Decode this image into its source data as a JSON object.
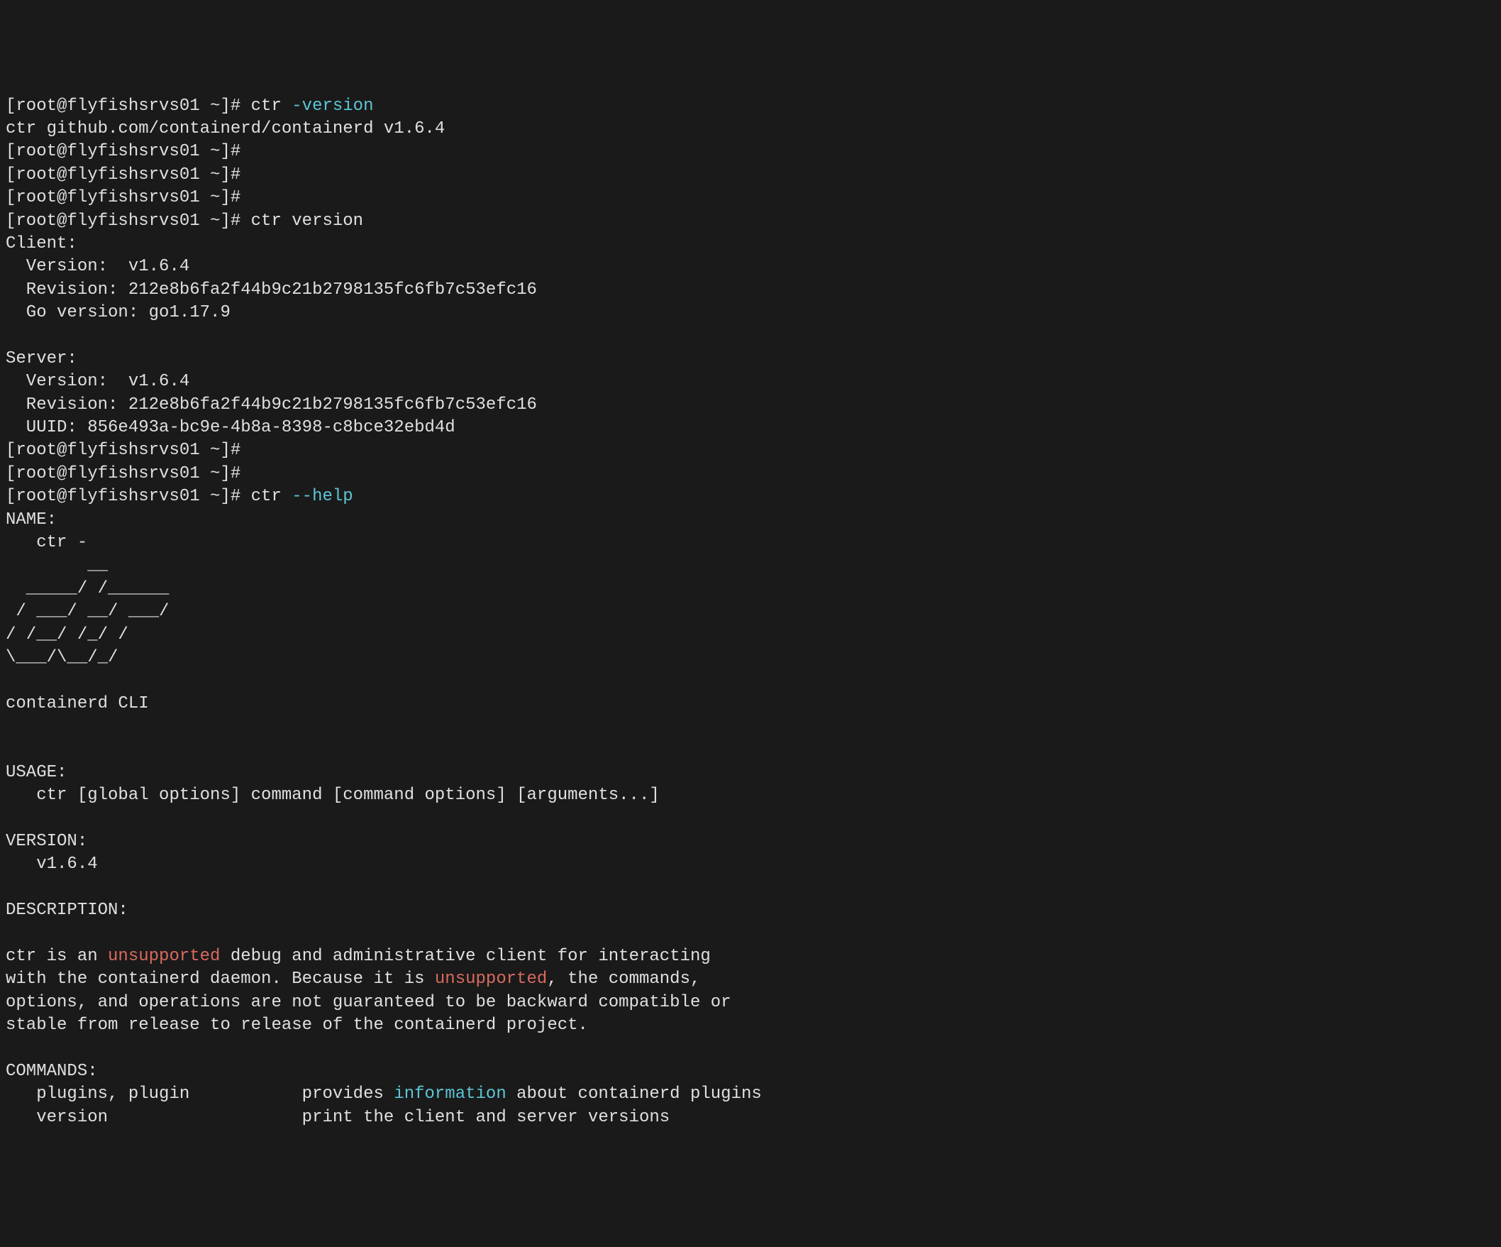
{
  "prompt": "[root@flyfishsrvs01 ~]# ",
  "cmd1_prefix": "ctr ",
  "cmd1_flag": "-version",
  "cmd1_output": "ctr github.com/containerd/containerd v1.6.4",
  "cmd2": "ctr version",
  "client_header": "Client:",
  "client_version": "  Version:  v1.6.4",
  "client_revision": "  Revision: 212e8b6fa2f44b9c21b2798135fc6fb7c53efc16",
  "client_goversion": "  Go version: go1.17.9",
  "server_header": "Server:",
  "server_version": "  Version:  v1.6.4",
  "server_revision": "  Revision: 212e8b6fa2f44b9c21b2798135fc6fb7c53efc16",
  "server_uuid": "  UUID: 856e493a-bc9e-4b8a-8398-c8bce32ebd4d",
  "cmd3_prefix": "ctr ",
  "cmd3_flag": "--help",
  "help_name_header": "NAME:",
  "help_name_body": "   ctr -",
  "ascii_art": "        __\n  _____/ /______\n / ___/ __/ ___/\n/ /__/ /_/ /\n\\___/\\__/_/",
  "help_cli_line": "containerd CLI",
  "help_usage_header": "USAGE:",
  "help_usage_body": "   ctr [global options] command [command options] [arguments...]",
  "help_version_header": "VERSION:",
  "help_version_body": "   v1.6.4",
  "help_description_header": "DESCRIPTION:",
  "desc_l1_a": "ctr is an ",
  "desc_l1_b": "unsupported",
  "desc_l1_c": " debug and administrative client for interacting",
  "desc_l2_a": "with the containerd daemon. Because it is ",
  "desc_l2_b": "unsupported",
  "desc_l2_c": ", the commands,",
  "desc_l3": "options, and operations are not guaranteed to be backward compatible or",
  "desc_l4": "stable from release to release of the containerd project.",
  "help_commands_header": "COMMANDS:",
  "cmd_plugins_a": "   plugins, plugin           provides ",
  "cmd_plugins_b": "information",
  "cmd_plugins_c": " about containerd plugins",
  "cmd_version": "   version                   print the client and server versions"
}
